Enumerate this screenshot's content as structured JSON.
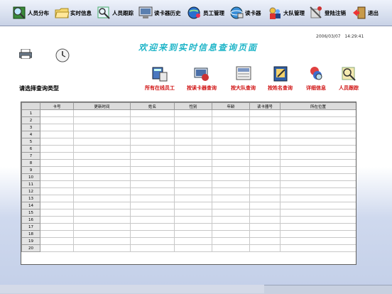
{
  "toolbar": {
    "items": [
      {
        "label": "人员分布",
        "icon": "magnifier-map-icon"
      },
      {
        "label": "实时信息",
        "icon": "folder-icon"
      },
      {
        "label": "人员跟踪",
        "icon": "tracking-icon"
      },
      {
        "label": "读卡器历史",
        "icon": "monitor-icon"
      },
      {
        "label": "员工管理",
        "icon": "globe-people-icon"
      },
      {
        "label": "读卡器",
        "icon": "card-reader-icon"
      },
      {
        "label": "大队管理",
        "icon": "team-icon"
      },
      {
        "label": "登陆注销",
        "icon": "tools-icon"
      },
      {
        "label": "退出",
        "icon": "exit-door-icon"
      }
    ]
  },
  "header": {
    "date": "2006/03/07",
    "time": "14:29:41",
    "title": "欢迎来到实时信息查询页面"
  },
  "query": {
    "prompt": "请选择查询类型",
    "buttons": [
      {
        "label": "所有在线员工",
        "icon": "all-online-icon"
      },
      {
        "label": "按读卡器查询",
        "icon": "reader-query-icon"
      },
      {
        "label": "按大队查询",
        "icon": "team-query-icon"
      },
      {
        "label": "按姓名查询",
        "icon": "name-query-icon"
      },
      {
        "label": "详细信息",
        "icon": "detail-icon"
      },
      {
        "label": "人员跟踪",
        "icon": "person-track-icon"
      }
    ]
  },
  "table": {
    "columns": [
      "卡号",
      "更新时间",
      "姓名",
      "性别",
      "年龄",
      "读卡器号",
      "所在位置"
    ],
    "rows": [
      "1",
      "2",
      "3",
      "4",
      "5",
      "6",
      "7",
      "8",
      "9",
      "10",
      "11",
      "12",
      "13",
      "14",
      "15",
      "16",
      "17",
      "18",
      "19",
      "20"
    ]
  }
}
